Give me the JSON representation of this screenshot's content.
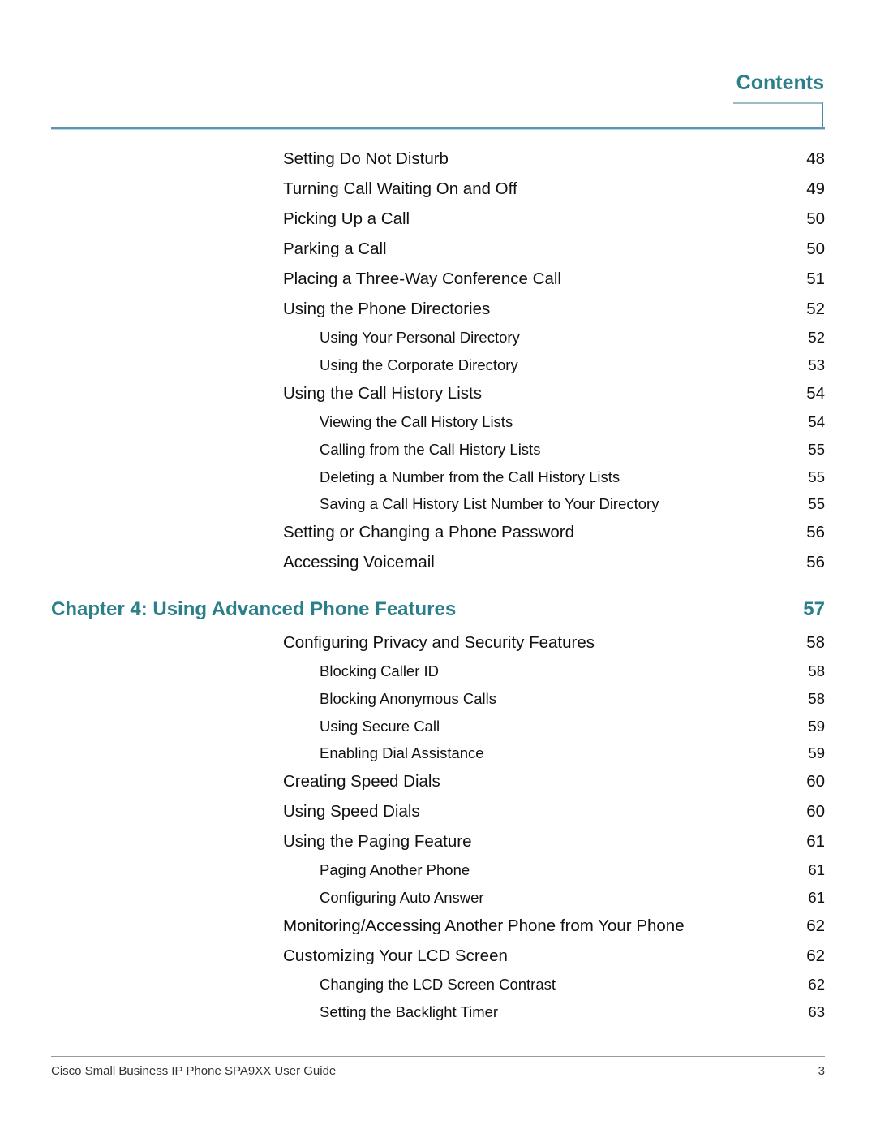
{
  "header": {
    "title": "Contents"
  },
  "entries_before": [
    {
      "level": 1,
      "title": "Setting Do Not Disturb",
      "page": "48"
    },
    {
      "level": 1,
      "title": "Turning Call Waiting On and Off",
      "page": "49"
    },
    {
      "level": 1,
      "title": "Picking Up a Call",
      "page": "50"
    },
    {
      "level": 1,
      "title": "Parking a Call",
      "page": "50"
    },
    {
      "level": 1,
      "title": "Placing a Three-Way Conference Call",
      "page": "51"
    },
    {
      "level": 1,
      "title": "Using the Phone Directories",
      "page": "52"
    },
    {
      "level": 2,
      "title": "Using Your Personal Directory",
      "page": "52"
    },
    {
      "level": 2,
      "title": "Using the Corporate Directory",
      "page": "53"
    },
    {
      "level": 1,
      "title": "Using the Call History Lists",
      "page": "54"
    },
    {
      "level": 2,
      "title": "Viewing the Call History Lists",
      "page": "54"
    },
    {
      "level": 2,
      "title": "Calling from the Call History Lists",
      "page": "55"
    },
    {
      "level": 2,
      "title": "Deleting a Number from the Call History Lists",
      "page": "55"
    },
    {
      "level": 2,
      "title": "Saving a Call History List Number to Your Directory",
      "page": "55"
    },
    {
      "level": 1,
      "title": "Setting or Changing a Phone Password",
      "page": "56"
    },
    {
      "level": 1,
      "title": "Accessing Voicemail",
      "page": "56"
    }
  ],
  "chapter": {
    "title": "Chapter 4: Using Advanced Phone Features",
    "page": "57"
  },
  "entries_after": [
    {
      "level": 1,
      "title": "Configuring Privacy and Security Features",
      "page": "58"
    },
    {
      "level": 2,
      "title": "Blocking Caller ID",
      "page": "58"
    },
    {
      "level": 2,
      "title": "Blocking Anonymous Calls",
      "page": "58"
    },
    {
      "level": 2,
      "title": "Using Secure Call",
      "page": "59"
    },
    {
      "level": 2,
      "title": "Enabling Dial Assistance",
      "page": "59"
    },
    {
      "level": 1,
      "title": "Creating Speed Dials",
      "page": "60"
    },
    {
      "level": 1,
      "title": "Using Speed Dials",
      "page": "60"
    },
    {
      "level": 1,
      "title": "Using the Paging Feature",
      "page": "61"
    },
    {
      "level": 2,
      "title": "Paging Another Phone",
      "page": "61"
    },
    {
      "level": 2,
      "title": "Configuring Auto Answer",
      "page": "61"
    },
    {
      "level": 1,
      "title": "Monitoring/Accessing Another Phone from Your Phone",
      "page": "62"
    },
    {
      "level": 1,
      "title": "Customizing Your LCD Screen",
      "page": "62"
    },
    {
      "level": 2,
      "title": "Changing the LCD Screen Contrast",
      "page": "62"
    },
    {
      "level": 2,
      "title": "Setting the Backlight Timer",
      "page": "63"
    }
  ],
  "footer": {
    "text": "Cisco Small Business IP Phone SPA9XX User Guide",
    "page": "3"
  },
  "colors": {
    "accent": "#2a7f8a",
    "rule": "#5a96b4"
  }
}
